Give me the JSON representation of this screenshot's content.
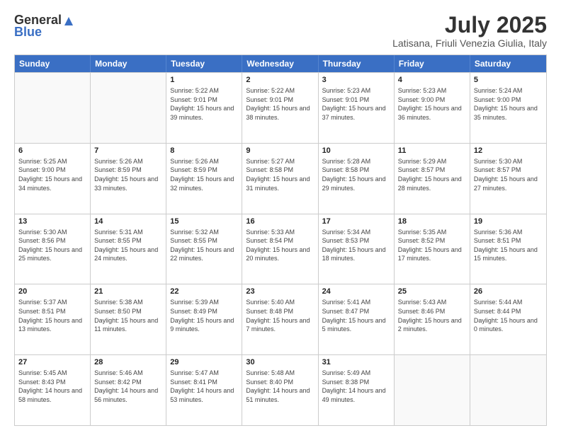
{
  "header": {
    "logo_general": "General",
    "logo_blue": "Blue",
    "month": "July 2025",
    "location": "Latisana, Friuli Venezia Giulia, Italy"
  },
  "days_of_week": [
    "Sunday",
    "Monday",
    "Tuesday",
    "Wednesday",
    "Thursday",
    "Friday",
    "Saturday"
  ],
  "weeks": [
    [
      {
        "day": "",
        "sunrise": "",
        "sunset": "",
        "daylight": ""
      },
      {
        "day": "",
        "sunrise": "",
        "sunset": "",
        "daylight": ""
      },
      {
        "day": "1",
        "sunrise": "Sunrise: 5:22 AM",
        "sunset": "Sunset: 9:01 PM",
        "daylight": "Daylight: 15 hours and 39 minutes."
      },
      {
        "day": "2",
        "sunrise": "Sunrise: 5:22 AM",
        "sunset": "Sunset: 9:01 PM",
        "daylight": "Daylight: 15 hours and 38 minutes."
      },
      {
        "day": "3",
        "sunrise": "Sunrise: 5:23 AM",
        "sunset": "Sunset: 9:01 PM",
        "daylight": "Daylight: 15 hours and 37 minutes."
      },
      {
        "day": "4",
        "sunrise": "Sunrise: 5:23 AM",
        "sunset": "Sunset: 9:00 PM",
        "daylight": "Daylight: 15 hours and 36 minutes."
      },
      {
        "day": "5",
        "sunrise": "Sunrise: 5:24 AM",
        "sunset": "Sunset: 9:00 PM",
        "daylight": "Daylight: 15 hours and 35 minutes."
      }
    ],
    [
      {
        "day": "6",
        "sunrise": "Sunrise: 5:25 AM",
        "sunset": "Sunset: 9:00 PM",
        "daylight": "Daylight: 15 hours and 34 minutes."
      },
      {
        "day": "7",
        "sunrise": "Sunrise: 5:26 AM",
        "sunset": "Sunset: 8:59 PM",
        "daylight": "Daylight: 15 hours and 33 minutes."
      },
      {
        "day": "8",
        "sunrise": "Sunrise: 5:26 AM",
        "sunset": "Sunset: 8:59 PM",
        "daylight": "Daylight: 15 hours and 32 minutes."
      },
      {
        "day": "9",
        "sunrise": "Sunrise: 5:27 AM",
        "sunset": "Sunset: 8:58 PM",
        "daylight": "Daylight: 15 hours and 31 minutes."
      },
      {
        "day": "10",
        "sunrise": "Sunrise: 5:28 AM",
        "sunset": "Sunset: 8:58 PM",
        "daylight": "Daylight: 15 hours and 29 minutes."
      },
      {
        "day": "11",
        "sunrise": "Sunrise: 5:29 AM",
        "sunset": "Sunset: 8:57 PM",
        "daylight": "Daylight: 15 hours and 28 minutes."
      },
      {
        "day": "12",
        "sunrise": "Sunrise: 5:30 AM",
        "sunset": "Sunset: 8:57 PM",
        "daylight": "Daylight: 15 hours and 27 minutes."
      }
    ],
    [
      {
        "day": "13",
        "sunrise": "Sunrise: 5:30 AM",
        "sunset": "Sunset: 8:56 PM",
        "daylight": "Daylight: 15 hours and 25 minutes."
      },
      {
        "day": "14",
        "sunrise": "Sunrise: 5:31 AM",
        "sunset": "Sunset: 8:55 PM",
        "daylight": "Daylight: 15 hours and 24 minutes."
      },
      {
        "day": "15",
        "sunrise": "Sunrise: 5:32 AM",
        "sunset": "Sunset: 8:55 PM",
        "daylight": "Daylight: 15 hours and 22 minutes."
      },
      {
        "day": "16",
        "sunrise": "Sunrise: 5:33 AM",
        "sunset": "Sunset: 8:54 PM",
        "daylight": "Daylight: 15 hours and 20 minutes."
      },
      {
        "day": "17",
        "sunrise": "Sunrise: 5:34 AM",
        "sunset": "Sunset: 8:53 PM",
        "daylight": "Daylight: 15 hours and 18 minutes."
      },
      {
        "day": "18",
        "sunrise": "Sunrise: 5:35 AM",
        "sunset": "Sunset: 8:52 PM",
        "daylight": "Daylight: 15 hours and 17 minutes."
      },
      {
        "day": "19",
        "sunrise": "Sunrise: 5:36 AM",
        "sunset": "Sunset: 8:51 PM",
        "daylight": "Daylight: 15 hours and 15 minutes."
      }
    ],
    [
      {
        "day": "20",
        "sunrise": "Sunrise: 5:37 AM",
        "sunset": "Sunset: 8:51 PM",
        "daylight": "Daylight: 15 hours and 13 minutes."
      },
      {
        "day": "21",
        "sunrise": "Sunrise: 5:38 AM",
        "sunset": "Sunset: 8:50 PM",
        "daylight": "Daylight: 15 hours and 11 minutes."
      },
      {
        "day": "22",
        "sunrise": "Sunrise: 5:39 AM",
        "sunset": "Sunset: 8:49 PM",
        "daylight": "Daylight: 15 hours and 9 minutes."
      },
      {
        "day": "23",
        "sunrise": "Sunrise: 5:40 AM",
        "sunset": "Sunset: 8:48 PM",
        "daylight": "Daylight: 15 hours and 7 minutes."
      },
      {
        "day": "24",
        "sunrise": "Sunrise: 5:41 AM",
        "sunset": "Sunset: 8:47 PM",
        "daylight": "Daylight: 15 hours and 5 minutes."
      },
      {
        "day": "25",
        "sunrise": "Sunrise: 5:43 AM",
        "sunset": "Sunset: 8:46 PM",
        "daylight": "Daylight: 15 hours and 2 minutes."
      },
      {
        "day": "26",
        "sunrise": "Sunrise: 5:44 AM",
        "sunset": "Sunset: 8:44 PM",
        "daylight": "Daylight: 15 hours and 0 minutes."
      }
    ],
    [
      {
        "day": "27",
        "sunrise": "Sunrise: 5:45 AM",
        "sunset": "Sunset: 8:43 PM",
        "daylight": "Daylight: 14 hours and 58 minutes."
      },
      {
        "day": "28",
        "sunrise": "Sunrise: 5:46 AM",
        "sunset": "Sunset: 8:42 PM",
        "daylight": "Daylight: 14 hours and 56 minutes."
      },
      {
        "day": "29",
        "sunrise": "Sunrise: 5:47 AM",
        "sunset": "Sunset: 8:41 PM",
        "daylight": "Daylight: 14 hours and 53 minutes."
      },
      {
        "day": "30",
        "sunrise": "Sunrise: 5:48 AM",
        "sunset": "Sunset: 8:40 PM",
        "daylight": "Daylight: 14 hours and 51 minutes."
      },
      {
        "day": "31",
        "sunrise": "Sunrise: 5:49 AM",
        "sunset": "Sunset: 8:38 PM",
        "daylight": "Daylight: 14 hours and 49 minutes."
      },
      {
        "day": "",
        "sunrise": "",
        "sunset": "",
        "daylight": ""
      },
      {
        "day": "",
        "sunrise": "",
        "sunset": "",
        "daylight": ""
      }
    ]
  ]
}
